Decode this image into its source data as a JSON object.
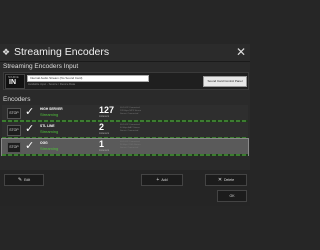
{
  "window": {
    "title": "Streaming Encoders",
    "close_glyph": "✕",
    "title_icon_glyph": "❖"
  },
  "input_section": {
    "label": "Streaming Encoders Input",
    "in_small": "SOURCE",
    "in_label": "IN",
    "selected_source": "Internal Audio Stream (No Sound Card)",
    "sub_text": "Available input - Source / Device Data",
    "sound_card_button": "Sound Card Control Panel"
  },
  "encoders_section": {
    "label": "Encoders",
    "items": [
      {
        "stop_label": "STOP",
        "name": "HIGH SERVER",
        "status": "Streaming",
        "count": "127",
        "listeners_label": "Listeners",
        "details": [
          "00:14:32 Connected",
          "128 kbps MP3 Stereo",
          "Server: Connected"
        ],
        "selected": false
      },
      {
        "stop_label": "STOP",
        "name": "STL LINE",
        "status": "Streaming",
        "count": "2",
        "listeners_label": "Listeners",
        "details": [
          "00:14:32 Connected",
          "64 kbps AAC Stereo",
          "Server: Connected"
        ],
        "selected": false
      },
      {
        "stop_label": "STOP",
        "name": "OGG",
        "status": "Streaming",
        "count": "1",
        "listeners_label": "Listeners",
        "details": [
          "00:14:32 Connected",
          "96 kbps OGG Stereo",
          "Server: Connected"
        ],
        "selected": true
      }
    ]
  },
  "buttons": {
    "edit": "Edit",
    "add": "Add",
    "delete": "Delete",
    "ok": "OK"
  },
  "icons": {
    "check": "✓",
    "edit": "✎",
    "add": "+",
    "delete": "✕"
  }
}
